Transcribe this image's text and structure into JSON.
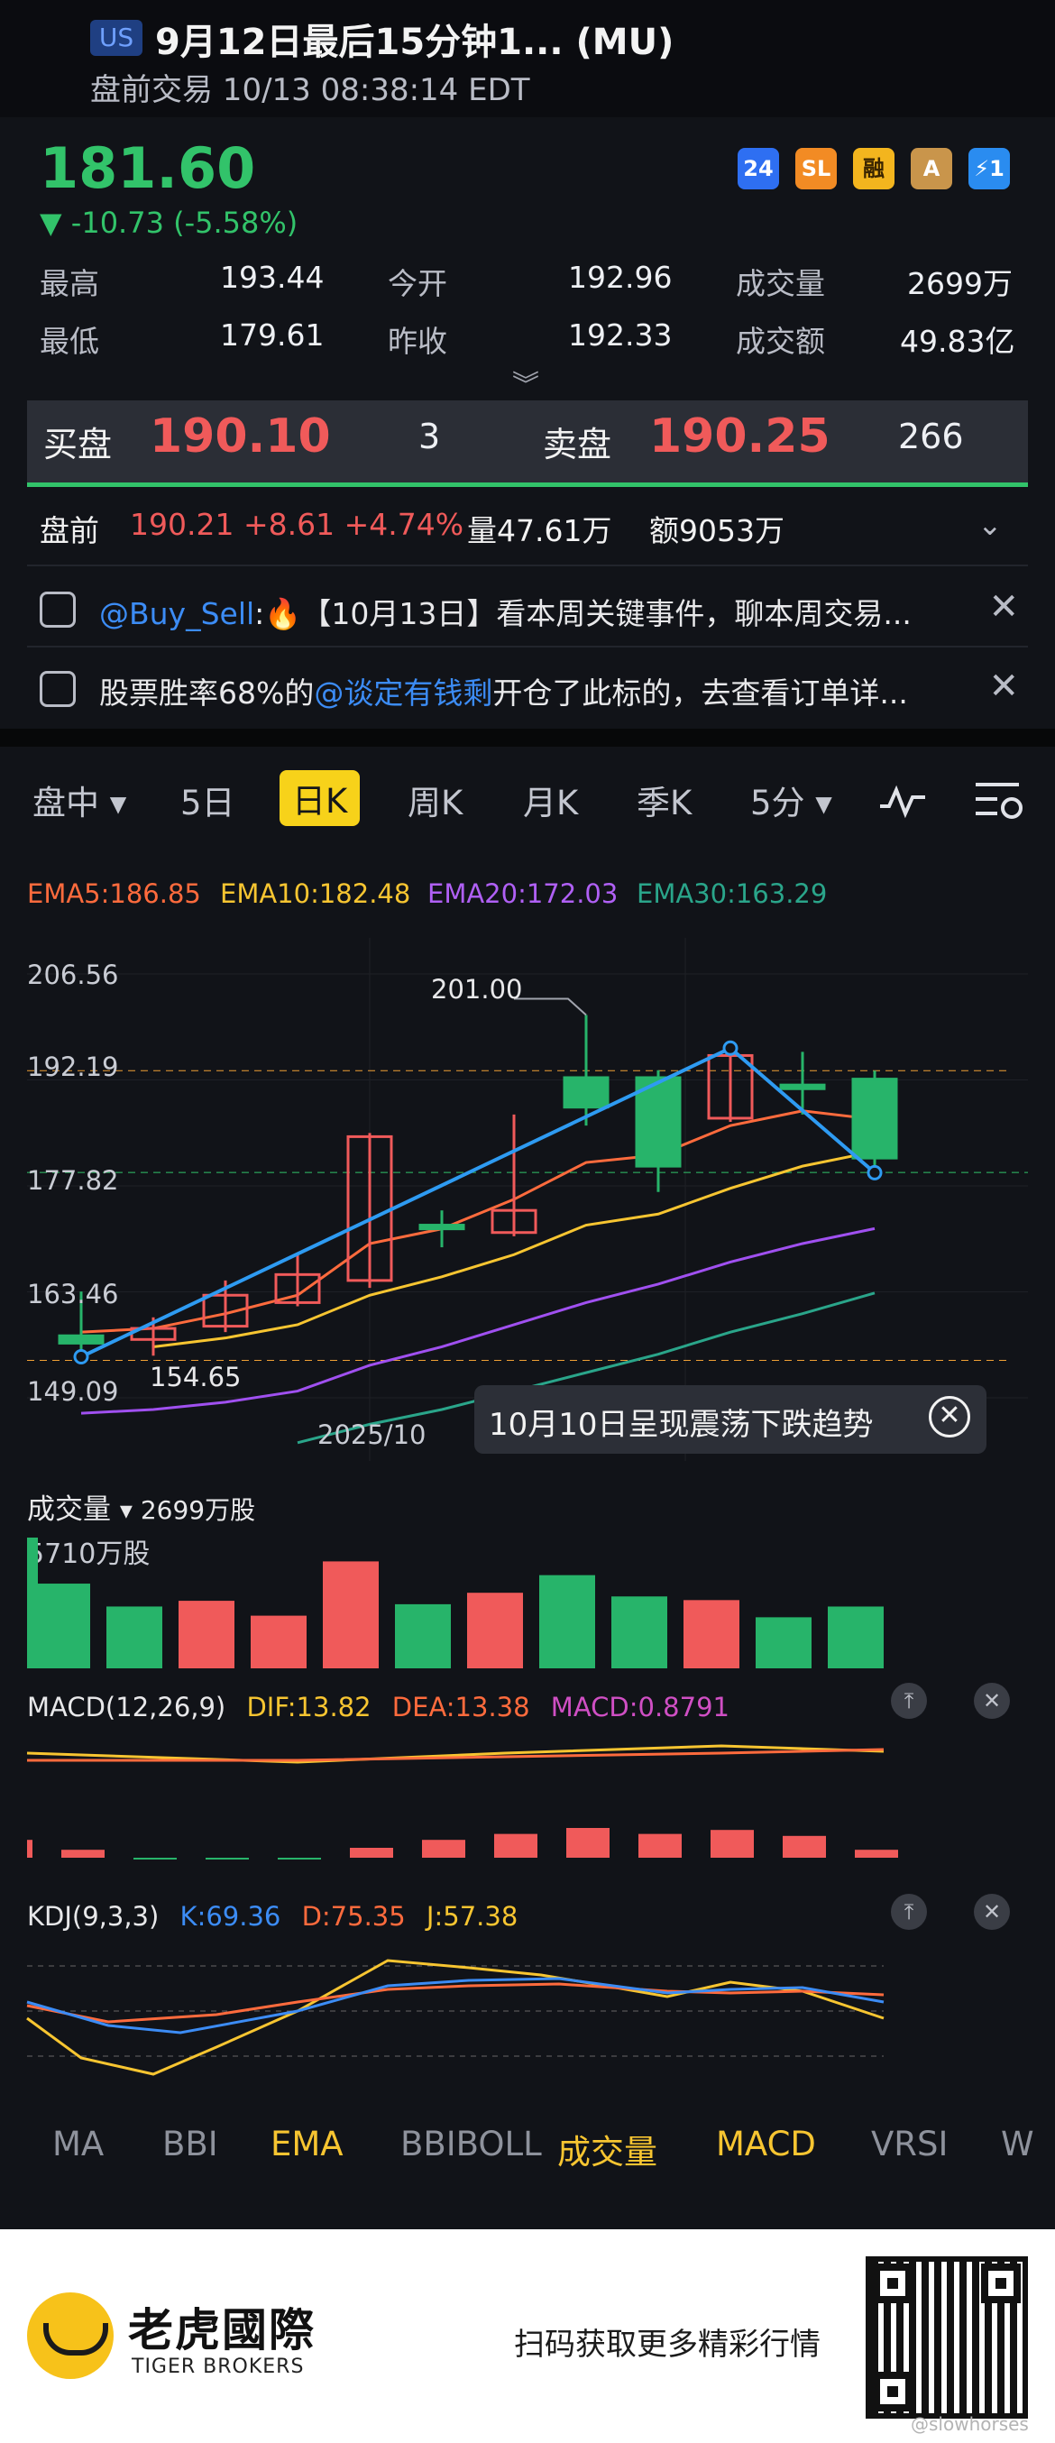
{
  "header": {
    "market_badge": "US",
    "title": "9月12日最后15分钟1...  (MU)",
    "subtitle": "盘前交易 10/13 08:38:14 EDT"
  },
  "quote": {
    "price": "181.60",
    "change": "▼ -10.73 (-5.58%)",
    "badges": [
      "24",
      "SL",
      "融",
      "A",
      "⚡1"
    ],
    "stats": {
      "high_label": "最高",
      "high": "193.44",
      "open_label": "今开",
      "open": "192.96",
      "volume_label": "成交量",
      "volume": "2699万",
      "low_label": "最低",
      "low": "179.61",
      "prev_close_label": "昨收",
      "prev_close": "192.33",
      "amount_label": "成交额",
      "amount": "49.83亿"
    }
  },
  "order_book": {
    "bid_label": "买盘",
    "bid": "190.10",
    "bid_qty": "3",
    "ask_label": "卖盘",
    "ask": "190.25",
    "ask_qty": "266"
  },
  "premarket": {
    "label": "盘前",
    "value": "190.21 +8.61 +4.74%",
    "volume": "量47.61万",
    "amount": "额9053万"
  },
  "news": [
    {
      "prefix": "@Buy_Sell",
      "text": ":🔥【10月13日】看本周关键事件，聊本周交易..."
    },
    {
      "prefix": "股票胜率68%的",
      "link": "@谈定有钱剩",
      "text": "开仓了此标的，去查看订单详..."
    }
  ],
  "tabs": [
    "盘中 ▾",
    "5日",
    "日K",
    "周K",
    "月K",
    "季K",
    "5分 ▾"
  ],
  "ema_legend": {
    "ema5": "EMA5:186.85",
    "ema10": "EMA10:182.48",
    "ema20": "EMA20:172.03",
    "ema30": "EMA30:163.29"
  },
  "colors": {
    "up": "#f05a5a",
    "down": "#27b46a",
    "ema5": "#ff6b3d",
    "ema10": "#f7c531",
    "ema20": "#a050f0",
    "ema30": "#2aa58a",
    "trend": "#2e9bf2"
  },
  "chart_labels": {
    "y_ticks": [
      "206.56",
      "192.19",
      "177.82",
      "163.46",
      "149.09"
    ],
    "high_marker": "201.00",
    "low_marker": "154.65",
    "x_label": "2025/10",
    "popup": "10月10日呈现震荡下跌趋势"
  },
  "chart_data": {
    "type": "candlestick",
    "ylim": [
      149.09,
      206.56
    ],
    "y_ticks": [
      206.56,
      192.19,
      177.82,
      163.46,
      149.09
    ],
    "candles": [
      {
        "o": 157.5,
        "c": 156.5,
        "h": 163.5,
        "l": 154.65
      },
      {
        "o": 157.0,
        "c": 158.5,
        "h": 160.0,
        "l": 154.8
      },
      {
        "o": 158.8,
        "c": 163.0,
        "h": 165.0,
        "l": 158.0
      },
      {
        "o": 162.0,
        "c": 165.8,
        "h": 168.5,
        "l": 161.5
      },
      {
        "o": 165.0,
        "c": 184.5,
        "h": 185.0,
        "l": 164.0
      },
      {
        "o": 172.5,
        "c": 172.0,
        "h": 174.5,
        "l": 169.5
      },
      {
        "o": 171.5,
        "c": 174.5,
        "h": 187.5,
        "l": 171.0
      },
      {
        "o": 192.5,
        "c": 188.5,
        "h": 201.0,
        "l": 186.0
      },
      {
        "o": 192.5,
        "c": 180.5,
        "h": 193.5,
        "l": 177.0
      },
      {
        "o": 187.0,
        "c": 195.5,
        "h": 196.5,
        "l": 186.5
      },
      {
        "o": 191.5,
        "c": 191.0,
        "h": 196.0,
        "l": 187.5
      },
      {
        "o": 192.3,
        "c": 181.6,
        "h": 193.44,
        "l": 179.61
      }
    ],
    "ema5": [
      158.0,
      158.5,
      160.5,
      163.0,
      170.0,
      172.0,
      176.0,
      181.0,
      182.0,
      186.0,
      188.0,
      186.85
    ],
    "ema10": [
      null,
      156.0,
      157.2,
      159.0,
      163.0,
      165.5,
      168.5,
      172.5,
      174.0,
      177.5,
      180.5,
      182.48
    ],
    "ema20": [
      147.0,
      147.5,
      148.5,
      150.0,
      153.5,
      156.0,
      159.0,
      162.0,
      164.5,
      167.5,
      170.0,
      172.03
    ],
    "ema30": [
      null,
      null,
      null,
      143.0,
      145.5,
      147.5,
      150.0,
      152.5,
      155.0,
      158.0,
      160.5,
      163.29
    ],
    "volume": [
      5710,
      3700,
      2700,
      2950,
      2300,
      4670,
      2800,
      3300,
      4070,
      3140,
      2980,
      2230,
      2699
    ],
    "volume_colors": [
      "down",
      "down",
      "down",
      "up",
      "up",
      "up",
      "down",
      "up",
      "down",
      "down",
      "up",
      "down",
      "down"
    ],
    "macd": {
      "dif": 13.82,
      "dea": 13.38,
      "macd": 0.8791
    },
    "kdj": {
      "k": 69.36,
      "d": 75.35,
      "j": 57.38
    }
  },
  "volume_panel": {
    "title": "成交量",
    "dropdown": "▾ 2699万股",
    "max_label": "5710万股"
  },
  "macd_panel": {
    "title": "MACD(12,26,9)",
    "dif": "DIF:13.82",
    "dea": "DEA:13.38",
    "macd": "MACD:0.8791"
  },
  "kdj_panel": {
    "title": "KDJ(9,3,3)",
    "k": "K:69.36",
    "d": "D:75.35",
    "j": "J:57.38"
  },
  "indicator_tabs": [
    "MA",
    "BBI",
    "EMA",
    "BBIBOLL",
    "成交量",
    "MACD",
    "VRSI",
    "W"
  ],
  "footer": {
    "brand_cn": "老虎國際",
    "brand_en": "TIGER BROKERS",
    "scan_text": "扫码获取更多精彩行情",
    "watermark": "@slowhorses"
  }
}
